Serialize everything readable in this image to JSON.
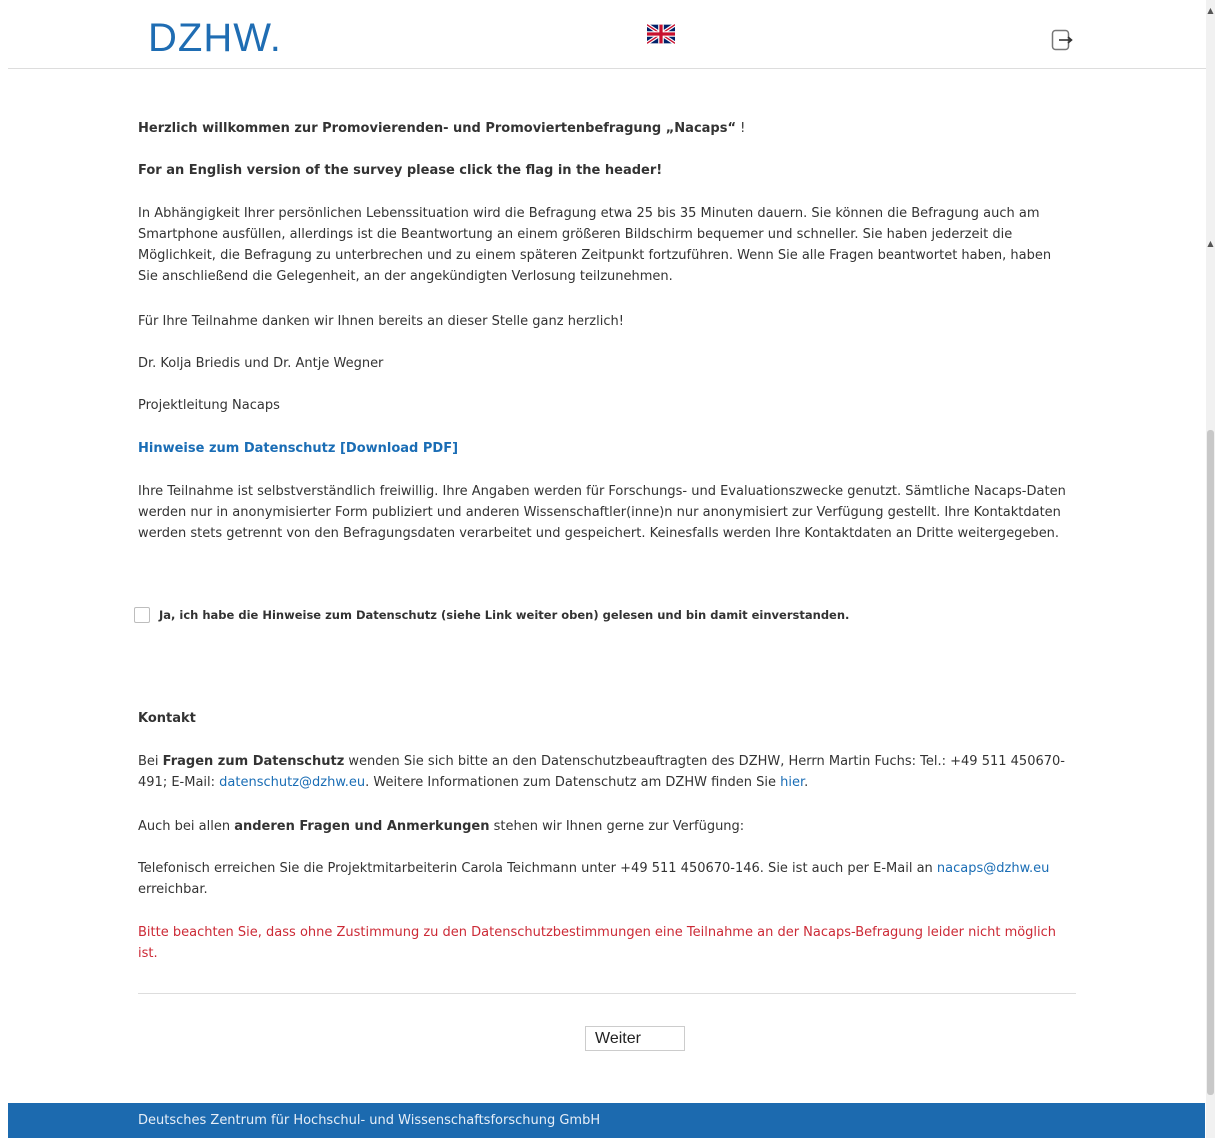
{
  "header": {
    "logo_text": "DZHW.",
    "flag_icon": "uk-flag-icon",
    "logout_icon": "logout-icon",
    "brand_color": "#1f6db3"
  },
  "intro": {
    "welcome_prefix": "Herzlich willkommen zur Promovierenden- und Promoviertenbefragung „Nacaps“",
    "welcome_suffix": " !",
    "english_note": "For an English version of the survey please click the flag in the header!",
    "duration_text": "In Abhängigkeit Ihrer persönlichen Lebenssituation wird die Befragung etwa 25 bis 35 Minuten dauern. Sie können die Befragung auch am Smartphone ausfüllen, allerdings ist die Beantwortung an einem größeren Bildschirm bequemer und schneller. Sie haben jederzeit die Möglichkeit, die Befragung zu unterbrechen und zu einem späteren Zeitpunkt fortzuführen. Wenn Sie alle Fragen beantwortet haben, haben Sie anschließend die Gelegenheit, an der angekündigten Verlosung teilzunehmen.",
    "thanks_text": "Für Ihre Teilnahme danken wir Ihnen bereits an dieser Stelle ganz herzlich!",
    "signature_names": "Dr. Kolja Briedis und Dr. Antje Wegner",
    "signature_role": "Projektleitung Nacaps"
  },
  "privacy": {
    "link_label": "Hinweise zum Datenschutz [Download PDF]",
    "text": "Ihre Teilnahme ist selbstverständlich freiwillig. Ihre Angaben werden für Forschungs- und Evaluationszwecke genutzt. Sämtliche Nacaps-Daten werden nur in anonymisierter Form publiziert und anderen Wissenschaftler(inne)n nur anonymisiert zur Verfügung gestellt. Ihre Kontaktdaten werden stets getrennt von den Befragungsdaten verarbeitet und gespeichert. Keinesfalls werden Ihre Kontaktdaten an Dritte weitergegeben.",
    "consent_label": "Ja, ich habe die Hinweise zum Datenschutz (siehe Link weiter oben) gelesen und bin damit einverstanden.",
    "consent_checked": false
  },
  "contact": {
    "heading": "Kontakt",
    "dp_prefix": "Bei ",
    "dp_bold": "Fragen zum Datenschutz",
    "dp_text": " wenden Sie sich bitte an den Datenschutzbeauftragten des DZHW, Herrn Martin Fuchs: Tel.: +49 511 450670-491; E-Mail: ",
    "dp_email": "datenschutz@dzhw.eu",
    "dp_more": ". Weitere Informationen zum Datenschutz am DZHW finden Sie ",
    "dp_here": "hier",
    "dp_end": ".",
    "other_prefix": "Auch bei allen ",
    "other_bold": "anderen Fragen und Anmerkungen",
    "other_suffix": " stehen wir Ihnen gerne zur Verfügung:",
    "phone_text": "Telefonisch erreichen Sie die Projektmitarbeiterin Carola Teichmann unter +49 511 450670-146. Sie ist auch per E-Mail an ",
    "phone_email": "nacaps@dzhw.eu",
    "phone_end": " erreichbar.",
    "warning": "Bitte beachten Sie, dass ohne Zustimmung zu den Datenschutzbestimmungen eine Teilnahme an der Nacaps-Befragung leider nicht möglich ist."
  },
  "navigation": {
    "next_label": "Weiter"
  },
  "footer": {
    "text": "Deutsches Zentrum für Hochschul- und Wissenschaftsforschung GmbH",
    "color": "#1c6aaf"
  },
  "scrollbar": {
    "up_arrow": "▲",
    "mark": "▲"
  }
}
